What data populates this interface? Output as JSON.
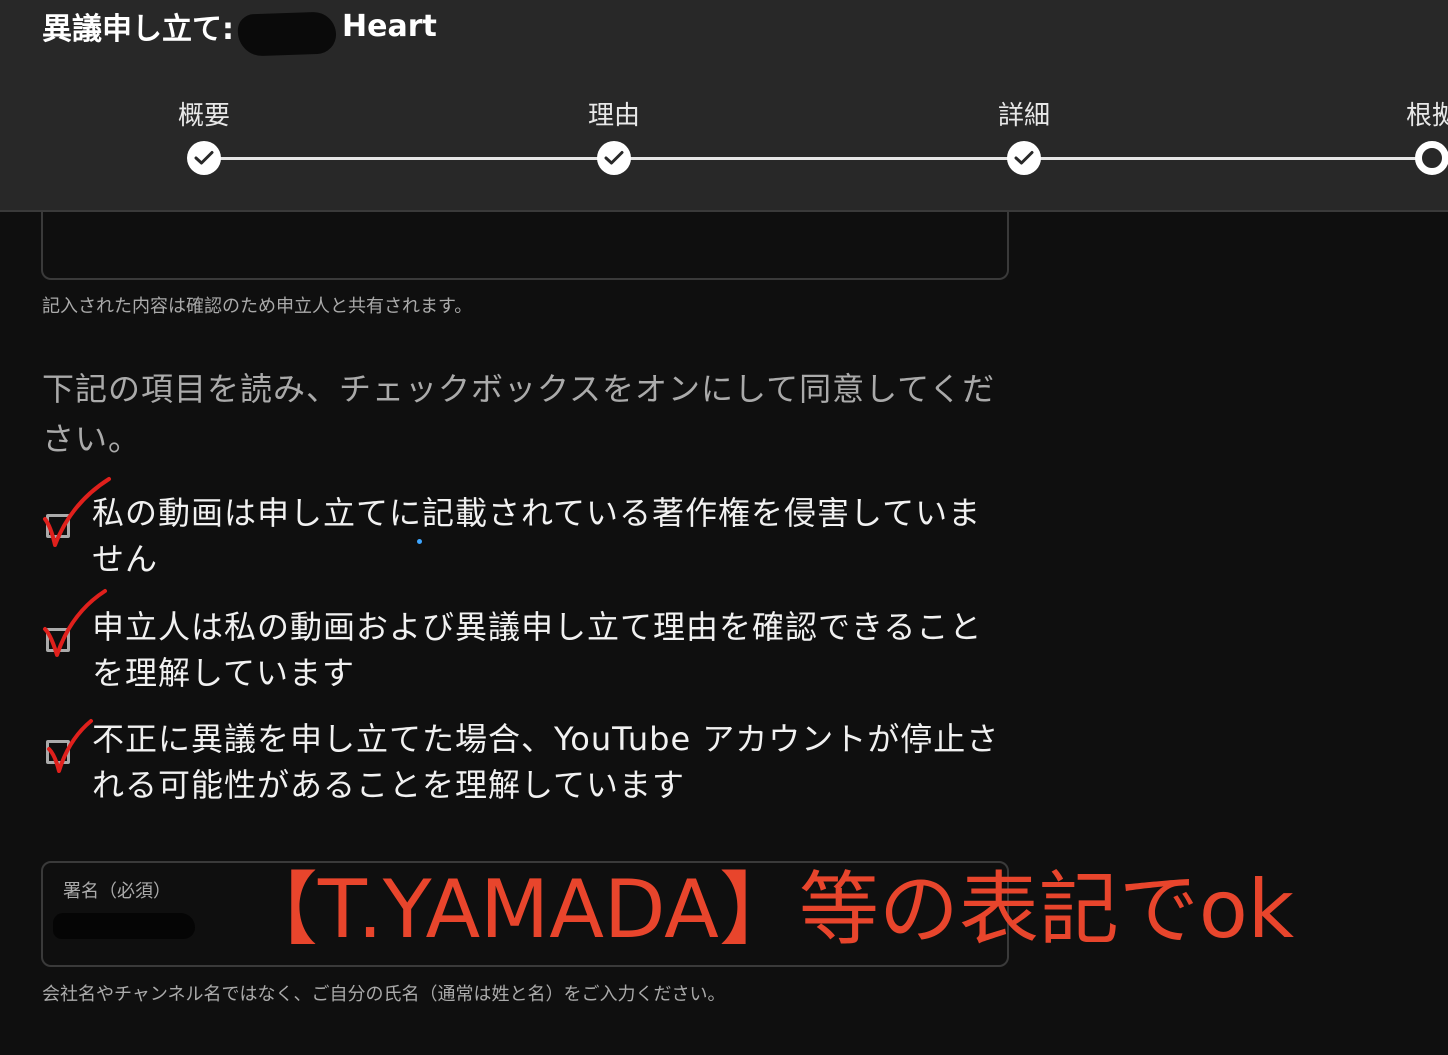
{
  "header": {
    "title_prefix": "異議申し立て:",
    "title_suffix": "Heart",
    "steps": [
      {
        "label": "概要",
        "state": "complete"
      },
      {
        "label": "理由",
        "state": "complete"
      },
      {
        "label": "詳細",
        "state": "complete"
      },
      {
        "label": "根拠",
        "state": "current"
      }
    ]
  },
  "form": {
    "share_note": "記入された内容は確認のため申立人と共有されます。",
    "instruction": "下記の項目を読み、チェックボックスをオンにして同意してください。",
    "checkboxes": [
      {
        "label": "私の動画は申し立てに記載されている著作権を侵害していません",
        "checked": true
      },
      {
        "label": "申立人は私の動画および異議申し立て理由を確認できることを理解しています",
        "checked": true
      },
      {
        "label": "不正に異議を申し立てた場合、YouTube アカウントが停止される可能性があることを理解しています",
        "checked": true
      }
    ],
    "signature": {
      "label": "署名（必須）",
      "helper": "会社名やチャンネル名ではなく、ご自分の氏名（通常は姓と名）をご入力ください。"
    }
  },
  "annotation": {
    "text": "【T.YAMADA】等の表記でok",
    "color": "#e8452c"
  },
  "colors": {
    "background": "#0f0f0f",
    "header_background": "#282828",
    "check_mark": "#e0201c"
  }
}
